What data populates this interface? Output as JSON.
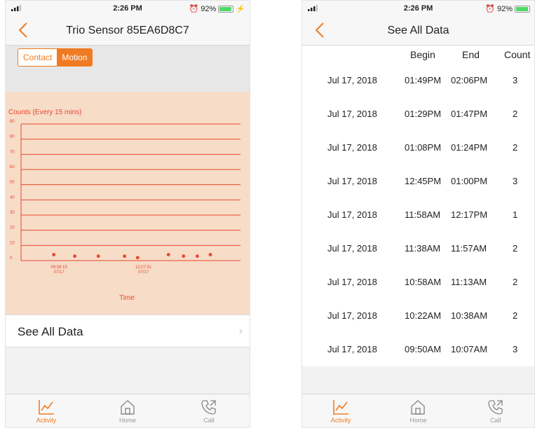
{
  "status": {
    "time": "2:26 PM",
    "battery": "92%",
    "battery_level": 0.92
  },
  "left": {
    "title": "Trio Sensor 85EA6D8C7",
    "segment": {
      "contact": "Contact",
      "motion": "Motion",
      "selected": "Motion"
    },
    "see_all": "See All Data"
  },
  "chart_data": {
    "type": "scatter",
    "title": "Counts (Every 15 mins)",
    "xlabel": "Time",
    "ylabel": "",
    "ylim": [
      0,
      90
    ],
    "yticks": [
      0,
      10,
      20,
      30,
      40,
      50,
      60,
      70,
      80,
      90
    ],
    "xtick_labels": [
      {
        "time": "09:58:15",
        "date": "07/17"
      },
      {
        "time": "12:07:51",
        "date": "07/17"
      }
    ],
    "points": [
      {
        "x": "09:50",
        "y": 3
      },
      {
        "x": "10:22",
        "y": 2
      },
      {
        "x": "10:58",
        "y": 2
      },
      {
        "x": "11:38",
        "y": 2
      },
      {
        "x": "11:58",
        "y": 1
      },
      {
        "x": "12:45",
        "y": 3
      },
      {
        "x": "13:08",
        "y": 2
      },
      {
        "x": "13:29",
        "y": 2
      },
      {
        "x": "13:49",
        "y": 3
      }
    ],
    "grid": true,
    "color": "#e8472c"
  },
  "right": {
    "title": "See All Data",
    "columns": {
      "begin": "Begin",
      "end": "End",
      "count": "Count"
    },
    "rows": [
      {
        "date": "Jul 17, 2018",
        "begin": "01:49PM",
        "end": "02:06PM",
        "count": "3"
      },
      {
        "date": "Jul 17, 2018",
        "begin": "01:29PM",
        "end": "01:47PM",
        "count": "2"
      },
      {
        "date": "Jul 17, 2018",
        "begin": "01:08PM",
        "end": "01:24PM",
        "count": "2"
      },
      {
        "date": "Jul 17, 2018",
        "begin": "12:45PM",
        "end": "01:00PM",
        "count": "3"
      },
      {
        "date": "Jul 17, 2018",
        "begin": "11:58AM",
        "end": "12:17PM",
        "count": "1"
      },
      {
        "date": "Jul 17, 2018",
        "begin": "11:38AM",
        "end": "11:57AM",
        "count": "2"
      },
      {
        "date": "Jul 17, 2018",
        "begin": "10:58AM",
        "end": "11:13AM",
        "count": "2"
      },
      {
        "date": "Jul 17, 2018",
        "begin": "10:22AM",
        "end": "10:38AM",
        "count": "2"
      },
      {
        "date": "Jul 17, 2018",
        "begin": "09:50AM",
        "end": "10:07AM",
        "count": "3"
      }
    ]
  },
  "tabs": [
    {
      "label": "Activity",
      "icon": "activity-icon",
      "active": true
    },
    {
      "label": "Home",
      "icon": "home-icon",
      "active": false
    },
    {
      "label": "Call",
      "icon": "call-icon",
      "active": false
    }
  ],
  "colors": {
    "accent": "#f07b22",
    "chart_bg": "#f7dcc8",
    "chart_line": "#e8472c"
  }
}
